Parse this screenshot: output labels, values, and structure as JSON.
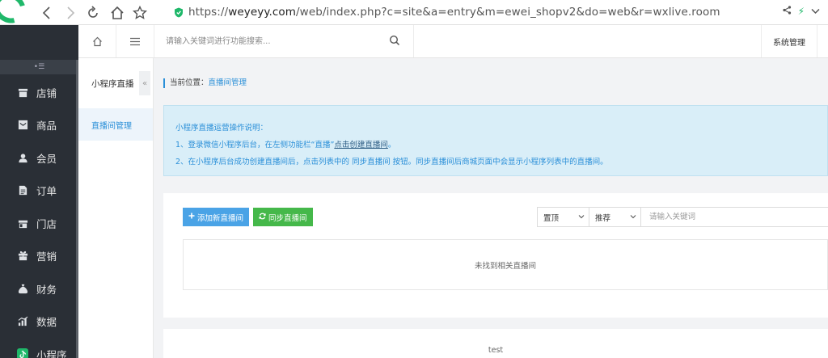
{
  "browser": {
    "url_scheme": "https://",
    "url_host": "weyeyy.com",
    "url_path": "/web/index.php?c=site&a=entry&m=ewei_shopv2&do=web&r=wxlive.room"
  },
  "sidebar": {
    "items": [
      {
        "label": "店铺",
        "icon": "store-icon"
      },
      {
        "label": "商品",
        "icon": "goods-icon"
      },
      {
        "label": "会员",
        "icon": "user-icon"
      },
      {
        "label": "订单",
        "icon": "order-icon"
      },
      {
        "label": "门店",
        "icon": "shop-icon"
      },
      {
        "label": "营销",
        "icon": "gift-icon"
      },
      {
        "label": "财务",
        "icon": "finance-icon"
      },
      {
        "label": "数据",
        "icon": "chart-icon"
      },
      {
        "label": "小程序",
        "icon": "miniapp-icon"
      }
    ],
    "collapse_glyph": "•☰"
  },
  "topbar": {
    "search_placeholder": "请输入关键词进行功能搜索...",
    "system_label": "系统管理"
  },
  "subnav": {
    "title": "小程序直播",
    "fold_glyph": "«",
    "items": [
      {
        "label": "直播间管理"
      }
    ]
  },
  "breadcrumb": {
    "prefix": "当前位置：",
    "current": "直播间管理"
  },
  "notice": {
    "title": "小程序直播运营操作说明：",
    "line1_prefix": "1、登录微信小程序后台，在左侧功能栏“直播”",
    "line1_link": "点击创建直播间",
    "line1_suffix": "。",
    "line2": "2、在小程序后台成功创建直播间后，点击列表中的 同步直播间 按钮。同步直播间后商城页面中会显示小程序列表中的直播间。"
  },
  "toolbar": {
    "add_label": "添加新直播间",
    "sync_label": "同步直播间",
    "filter1_value": "置顶",
    "filter2_value": "推荐",
    "keyword_placeholder": "请输入关键词"
  },
  "list": {
    "empty_text": "未找到相关直播间"
  },
  "footer": {
    "text": "test"
  },
  "colors": {
    "primary": "#2a8fd8",
    "add_button": "#4aa3e6",
    "sync_button": "#45b84a",
    "sidebar_bg": "#2a2f36",
    "notice_bg": "#d9eef8"
  }
}
